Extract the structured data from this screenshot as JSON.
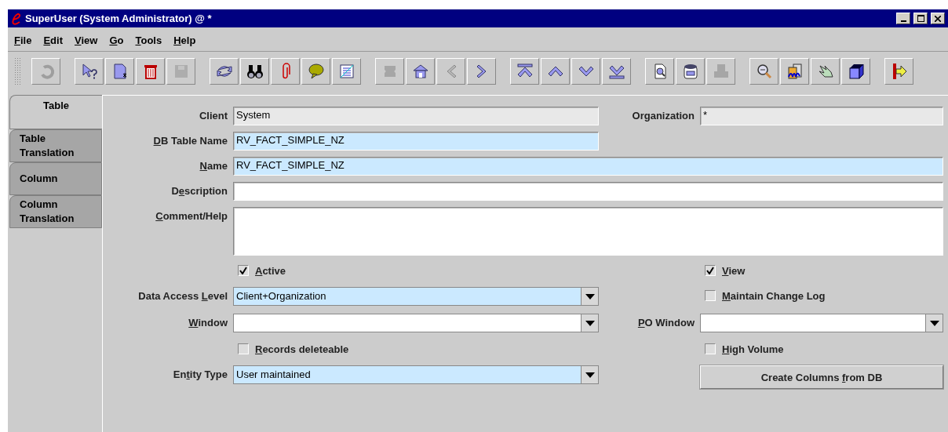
{
  "window": {
    "title": "SuperUser (System Administrator) @ *"
  },
  "menu": [
    {
      "key": "F",
      "post": "ile"
    },
    {
      "key": "E",
      "post": "dit"
    },
    {
      "key": "V",
      "post": "iew"
    },
    {
      "key": "G",
      "post": "o"
    },
    {
      "key": "T",
      "post": "ools"
    },
    {
      "key": "H",
      "post": "elp"
    }
  ],
  "toolbar": [
    {
      "buttons": [
        {
          "kind": "undo",
          "disabled": true
        }
      ]
    },
    {
      "buttons": [
        {
          "kind": "help",
          "disabled": false
        },
        {
          "kind": "new",
          "disabled": false
        },
        {
          "kind": "delete",
          "disabled": false
        },
        {
          "kind": "save",
          "disabled": true
        }
      ]
    },
    {
      "buttons": [
        {
          "kind": "refresh",
          "disabled": false
        },
        {
          "kind": "find",
          "disabled": false
        },
        {
          "kind": "attach",
          "disabled": false
        },
        {
          "kind": "chat",
          "disabled": false
        },
        {
          "kind": "report",
          "disabled": false
        }
      ]
    },
    {
      "buttons": [
        {
          "kind": "parent",
          "disabled": true
        },
        {
          "kind": "home",
          "disabled": false
        },
        {
          "kind": "prev",
          "disabled": true
        },
        {
          "kind": "next",
          "disabled": false
        }
      ]
    },
    {
      "buttons": [
        {
          "kind": "first",
          "disabled": false
        },
        {
          "kind": "up",
          "disabled": false
        },
        {
          "kind": "down",
          "disabled": false
        },
        {
          "kind": "last",
          "disabled": false
        }
      ]
    },
    {
      "buttons": [
        {
          "kind": "preview",
          "disabled": false
        },
        {
          "kind": "archive",
          "disabled": false
        },
        {
          "kind": "print",
          "disabled": true
        }
      ]
    },
    {
      "buttons": [
        {
          "kind": "zoom",
          "disabled": false
        },
        {
          "kind": "workflow",
          "disabled": false
        },
        {
          "kind": "product",
          "disabled": false
        },
        {
          "kind": "box",
          "disabled": false
        }
      ]
    },
    {
      "buttons": [
        {
          "kind": "exit",
          "disabled": false
        }
      ]
    }
  ],
  "tabs": [
    {
      "label": "Table",
      "selected": true
    },
    {
      "label": "Table Translation",
      "selected": false
    },
    {
      "label": "Column",
      "selected": false
    },
    {
      "label": "Column Translation",
      "selected": false
    }
  ],
  "form": {
    "rows": [
      {
        "left": {
          "kind": "text",
          "label": {
            "post": "Client"
          },
          "read_only": true,
          "value": "System"
        },
        "right": {
          "kind": "text",
          "label": {
            "post": "Organization"
          },
          "read_only": true,
          "value": "*"
        }
      },
      {
        "left": {
          "kind": "text",
          "label": {
            "key": "D",
            "post": "B Table Name"
          },
          "read_only": false,
          "mandatory": true,
          "value": "RV_FACT_SIMPLE_NZ"
        }
      },
      {
        "full": {
          "kind": "text",
          "label": {
            "key": "N",
            "post": "ame"
          },
          "read_only": false,
          "mandatory": true,
          "value": "RV_FACT_SIMPLE_NZ"
        }
      },
      {
        "full": {
          "kind": "text",
          "label": {
            "pre": "D",
            "key": "e",
            "post": "scription"
          },
          "read_only": false,
          "mandatory": false
        }
      },
      {
        "full": {
          "kind": "textarea",
          "label": {
            "key": "C",
            "post": "omment/Help"
          },
          "read_only": false,
          "mandatory": false
        }
      },
      {
        "left": {
          "kind": "checkbox",
          "label": {
            "key": "A",
            "post": "ctive"
          },
          "checked": true
        },
        "right": {
          "kind": "checkbox",
          "label": {
            "key": "V",
            "post": "iew"
          },
          "checked": true
        }
      },
      {
        "left": {
          "kind": "combo",
          "label": {
            "pre": "Data Access ",
            "key": "L",
            "post": "evel"
          },
          "read_only": false,
          "mandatory": true,
          "value": "Client+Organization"
        },
        "right": {
          "kind": "checkbox",
          "label": {
            "key": "M",
            "post": "aintain Change Log"
          },
          "checked": false
        }
      },
      {
        "left": {
          "kind": "combo",
          "label": {
            "key": "W",
            "post": "indow"
          },
          "read_only": false,
          "mandatory": false
        },
        "right": {
          "kind": "combo",
          "label": {
            "key": "P",
            "post": "O Window"
          },
          "read_only": false,
          "mandatory": false
        }
      },
      {
        "left": {
          "kind": "checkbox",
          "label": {
            "key": "R",
            "post": "ecords deleteable"
          },
          "checked": false
        },
        "right": {
          "kind": "checkbox",
          "label": {
            "key": "H",
            "post": "igh Volume"
          },
          "checked": false
        }
      },
      {
        "left": {
          "kind": "combo",
          "label": {
            "pre": "En",
            "key": "t",
            "post": "ity Type"
          },
          "read_only": false,
          "mandatory": true,
          "value": "User maintained"
        },
        "right": {
          "kind": "button",
          "label": {
            "pre": "Create Columns ",
            "key": "f",
            "post": "rom DB"
          }
        }
      }
    ]
  }
}
